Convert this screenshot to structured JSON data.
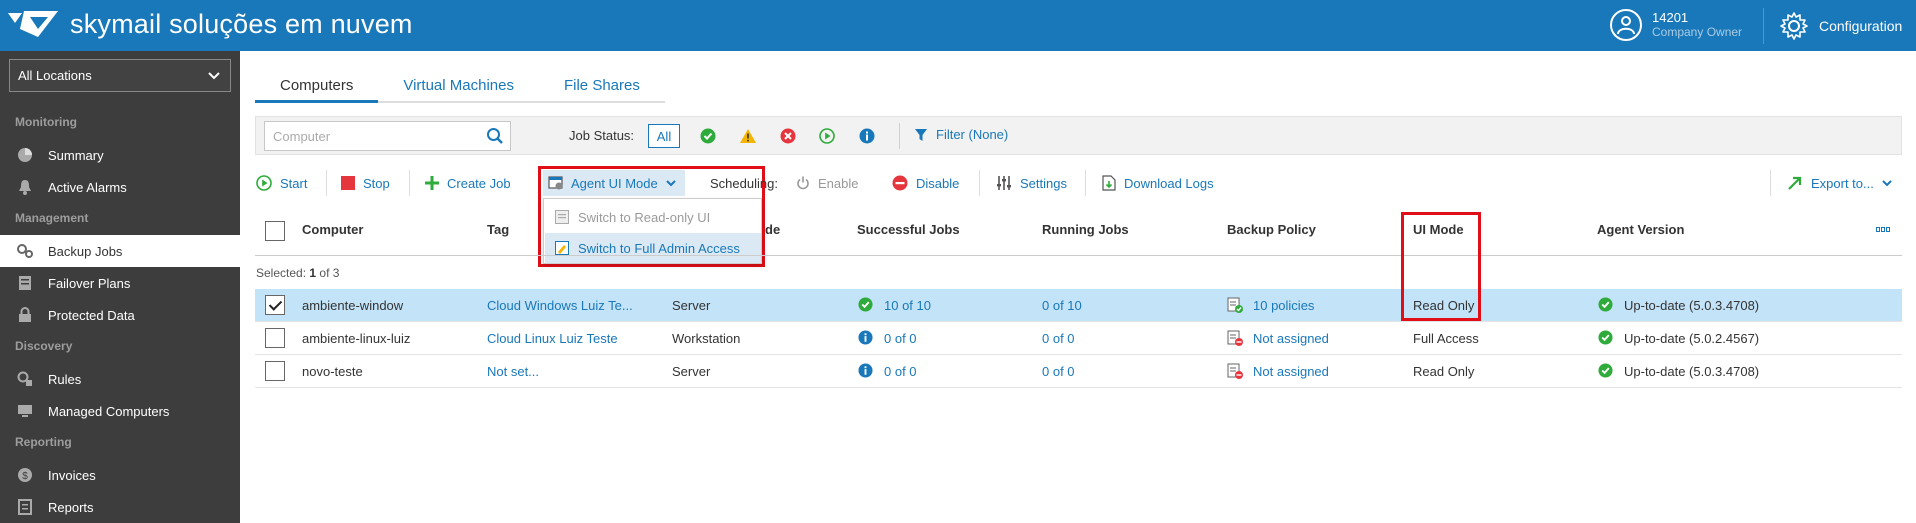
{
  "header": {
    "brand": "skymail soluções em nuvem",
    "user_id": "14201",
    "user_role": "Company Owner",
    "config_label": "Configuration"
  },
  "sidebar": {
    "location_select": "All Locations",
    "sections": {
      "monitoring": "Monitoring",
      "management": "Management",
      "discovery": "Discovery",
      "reporting": "Reporting"
    },
    "items": {
      "summary": "Summary",
      "active_alarms": "Active Alarms",
      "backup_jobs": "Backup Jobs",
      "failover_plans": "Failover Plans",
      "protected_data": "Protected Data",
      "rules": "Rules",
      "managed_computers": "Managed Computers",
      "invoices": "Invoices",
      "reports": "Reports"
    },
    "active_item": "Backup Jobs"
  },
  "tabs": [
    "Computers",
    "Virtual Machines",
    "File Shares"
  ],
  "active_tab": "Computers",
  "filterbar": {
    "search_placeholder": "Computer",
    "job_status_label": "Job Status:",
    "all_label": "All",
    "filter_label": "Filter (None)"
  },
  "toolbar": {
    "start": "Start",
    "stop": "Stop",
    "create_job": "Create Job",
    "agent_ui_mode": "Agent UI Mode",
    "scheduling": "Scheduling:",
    "enable": "Enable",
    "disable": "Disable",
    "settings": "Settings",
    "download_logs": "Download Logs",
    "export": "Export to..."
  },
  "agent_ui_menu": {
    "read_only": "Switch to Read-only UI",
    "full_admin": "Switch to Full Admin Access"
  },
  "table": {
    "columns": {
      "computer": "Computer",
      "tag": "Tag",
      "mode_partial": "de",
      "successful_jobs": "Successful Jobs",
      "running_jobs": "Running Jobs",
      "backup_policy": "Backup Policy",
      "ui_mode": "UI Mode",
      "agent_version": "Agent Version"
    },
    "selected_prefix": "Selected:",
    "selected_count": "1",
    "selected_suffix": "of 3",
    "rows": [
      {
        "computer": "ambiente-window",
        "tag": "Cloud Windows Luiz Te...",
        "mode": "Server",
        "successful_jobs": "10 of 10",
        "running_jobs": "0 of 10",
        "backup_policy": "10 policies",
        "ui_mode": "Read Only",
        "agent_version": "Up-to-date (5.0.3.4708)",
        "selected": true
      },
      {
        "computer": "ambiente-linux-luiz",
        "tag": "Cloud Linux Luiz Teste",
        "mode": "Workstation",
        "successful_jobs": "0 of 0",
        "running_jobs": "0 of 0",
        "backup_policy": "Not assigned",
        "ui_mode": "Full Access",
        "agent_version": "Up-to-date (5.0.2.4567)",
        "selected": false
      },
      {
        "computer": "novo-teste",
        "tag": "Not set...",
        "mode": "Server",
        "successful_jobs": "0 of 0",
        "running_jobs": "0 of 0",
        "backup_policy": "Not assigned",
        "ui_mode": "Read Only",
        "agent_version": "Up-to-date (5.0.3.4708)",
        "selected": false
      }
    ]
  },
  "colors": {
    "brand_blue": "#1978b9",
    "sidebar_bg": "#3d3d3d",
    "highlight_red": "#e00f17",
    "selected_row": "#c3e3f8",
    "success_green": "#2eab3b"
  }
}
